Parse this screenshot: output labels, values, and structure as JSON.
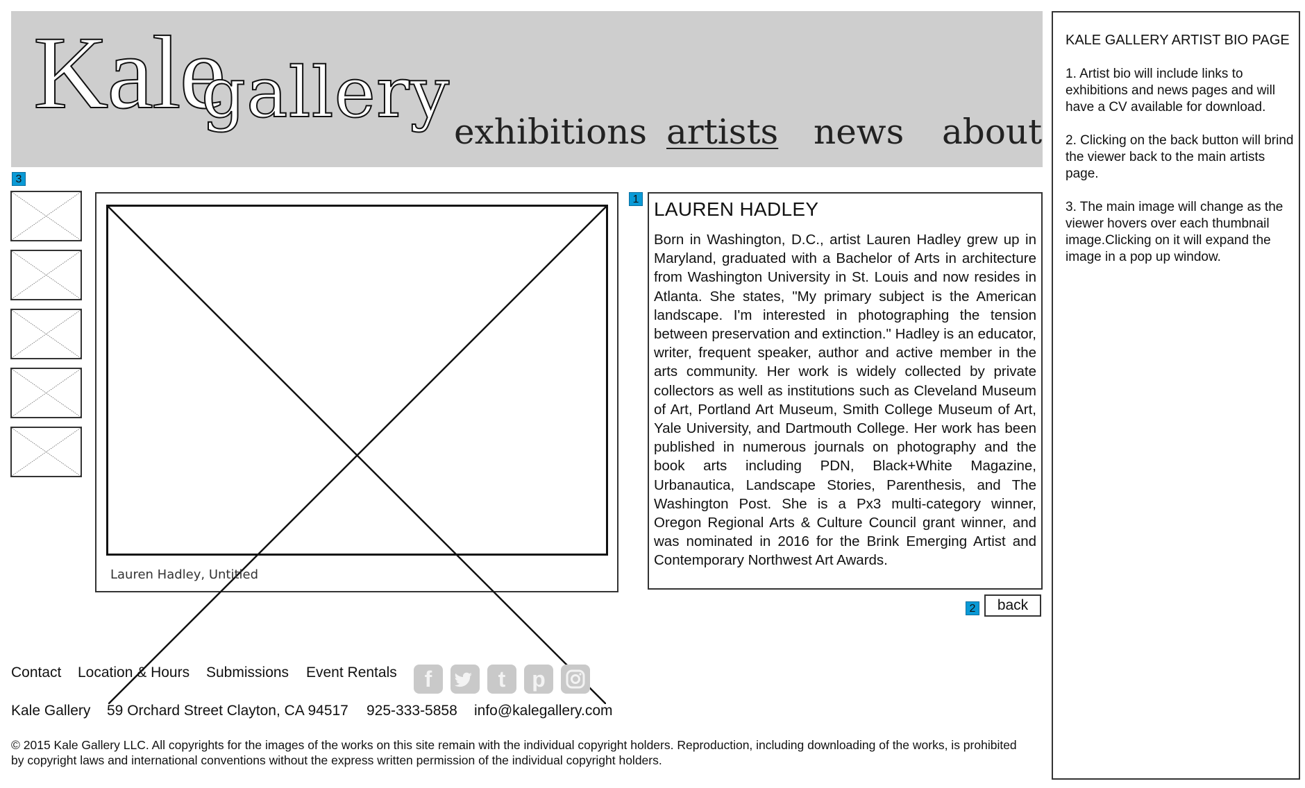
{
  "header": {
    "logo_kale": "Kale",
    "logo_gallery": "gallery",
    "nav": [
      {
        "label": "exhibitions",
        "active": false
      },
      {
        "label": "artists",
        "active": true
      },
      {
        "label": "news",
        "active": false
      },
      {
        "label": "about",
        "active": false
      }
    ]
  },
  "markers": {
    "thumbnails": "3",
    "bio": "1",
    "back": "2"
  },
  "gallery": {
    "thumbnail_count": 5,
    "caption": "Lauren Hadley, Untitled"
  },
  "bio": {
    "name": "LAUREN HADLEY",
    "text": "Born in Washington, D.C., artist Lauren Hadley grew up in Maryland, graduated with a Bachelor of Arts in architecture from Washington University in St. Louis and now resides in Atlanta. She states, \"My primary subject is the American landscape. I'm interested in photographing the tension between preservation and extinction.\" Hadley is an educator, writer, frequent speaker, author and active member in the arts community. Her work is widely collected by private collectors as well as institutions such as Cleveland Museum of Art, Portland Art Museum, Smith College Museum of Art, Yale University, and Dartmouth College. Her work has been published in numerous journals on photography and the book arts including PDN, Black+White Magazine, Urbanautica, Landscape Stories, Parenthesis, and The Washington Post. She is a Px3 multi-category winner, Oregon Regional Arts & Culture Council grant winner, and was nominated in 2016 for the Brink Emerging Artist and Contemporary Northwest Art Awards."
  },
  "back_label": "back",
  "footer": {
    "links": [
      "Contact",
      "Location & Hours",
      "Submissions",
      "Event Rentals"
    ],
    "social_icons": [
      "facebook-icon",
      "twitter-icon",
      "tumblr-icon",
      "pinterest-icon",
      "instagram-icon"
    ],
    "info": {
      "name": "Kale Gallery",
      "address": "59 Orchard Street Clayton, CA 94517",
      "phone": "925-333-5858",
      "email": "info@kalegallery.com"
    },
    "copyright": "© 2015 Kale Gallery LLC. All copyrights for the images of the works on this site remain with the individual copyright holders. Reproduction, including downloading of the works, is prohibited by copyright laws and international conventions without the express written permission of the individual copyright holders."
  },
  "notes": {
    "title": "KALE GALLERY ARTIST BIO PAGE",
    "items": [
      "1. Artist bio will include links to exhibitions and news pages and will have a CV available for download.",
      "2. Clicking on the back button will brind the viewer back to the main artists page.",
      "3. The main image will change as the viewer hovers over each thumbnail image.Clicking on it will expand the image in a pop up window."
    ]
  },
  "colors": {
    "header_bg": "#cecece",
    "marker": "#0a9ad6",
    "social_icon": "#c9c9c9"
  }
}
